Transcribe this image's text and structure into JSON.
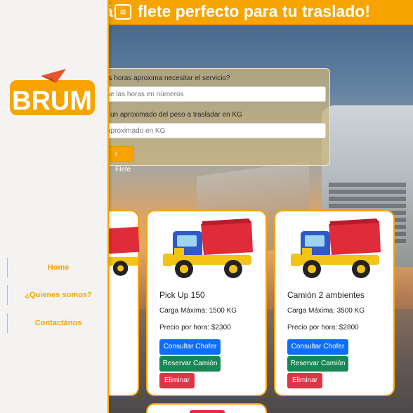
{
  "header": {
    "headline": "flete perfecto para tu traslado!",
    "headline_cut": "á",
    "menu_icon": "hamburger-icon"
  },
  "sidebar": {
    "logo_text": "BRUM",
    "nav": [
      {
        "label": "Home"
      },
      {
        "label": "¿Quienes somos?"
      },
      {
        "label": "Contactános"
      }
    ]
  },
  "form": {
    "hours_label": "as horas aproxima necesitar el servicio?",
    "hours_placeholder": "se las horas en números",
    "weight_label": "un aproximado del peso a trasladar en KG",
    "weight_placeholder": "aproximado en KG",
    "submit_label": "r Flete"
  },
  "cards": [
    {
      "title": "Pick Up 150",
      "capacity": "Carga Máxima: 1500 KG",
      "price": "Precio por hora: $2300",
      "consult": "Consultar Chofer",
      "reserve": "Reservar Camión",
      "delete": "Eliminar"
    },
    {
      "title": "Camión 2 ambientes",
      "capacity": "Carga Máxima: 3500 KG",
      "price": "Precio por hora: $2800",
      "consult": "Consultar Chofer",
      "reserve": "Reservar Camión",
      "delete": "Eliminar"
    }
  ],
  "colors": {
    "accent": "#f7a400",
    "primary": "#0d6efd",
    "success": "#198754",
    "danger": "#dc3545"
  }
}
